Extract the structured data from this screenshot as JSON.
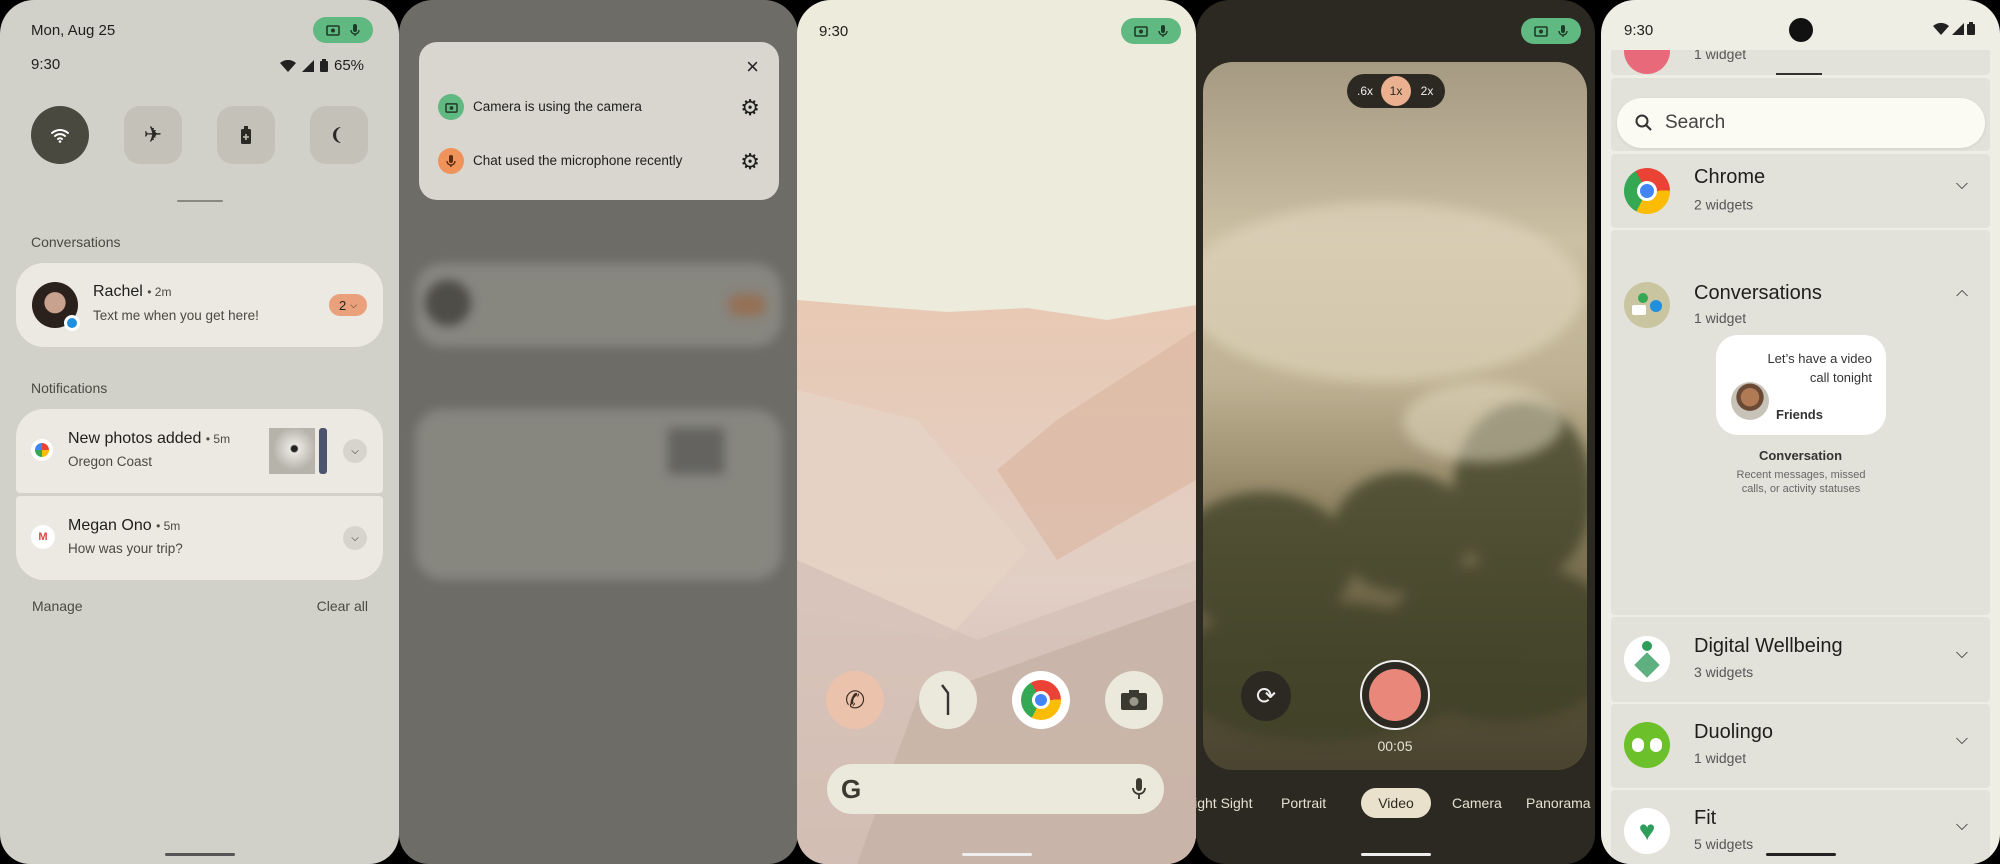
{
  "shade": {
    "date": "Mon, Aug 25",
    "time": "9:30",
    "battery": "65%",
    "tiles": [
      "wifi-icon",
      "airplane-icon",
      "battery-saver-icon",
      "dark-mode-icon"
    ],
    "conversations_header": "Conversations",
    "conversation": {
      "name": "Rachel",
      "time": "• 2m",
      "message": "Text me when you get here!",
      "count": "2"
    },
    "notifications_header": "Notifications",
    "notifications": [
      {
        "title": "New photos added",
        "time": "• 5m",
        "body": "Oregon Coast",
        "app": "google-photos-icon"
      },
      {
        "title": "Megan Ono",
        "time": "• 5m",
        "body": "How was your trip?",
        "app": "gmail-icon"
      }
    ],
    "manage": "Manage",
    "clear_all": "Clear all"
  },
  "privacy": {
    "items": [
      {
        "text": "Camera is using the camera",
        "color": "#5fb980"
      },
      {
        "text": "Chat used the microphone recently",
        "color": "#f0935a"
      }
    ]
  },
  "home": {
    "time": "9:30",
    "dock": [
      "phone-icon",
      "clock-icon",
      "chrome-icon",
      "camera-icon"
    ]
  },
  "camera": {
    "zoom": [
      ".6x",
      "1x",
      "2x"
    ],
    "timer": "00:05",
    "modes": [
      "Night Sight",
      "Portrait",
      "Video",
      "Camera",
      "Panorama"
    ],
    "active_mode": "Video"
  },
  "widgets": {
    "time": "9:30",
    "top_partial": "1 widget",
    "search_placeholder": "Search",
    "apps": [
      {
        "name": "Chrome",
        "count": "2 widgets"
      },
      {
        "name": "Conversations",
        "count": "1 widget"
      },
      {
        "name": "Digital Wellbeing",
        "count": "3 widgets"
      },
      {
        "name": "Duolingo",
        "count": "1 widget"
      },
      {
        "name": "Fit",
        "count": "5 widgets"
      }
    ],
    "preview": {
      "message": "Let’s have a video call tonight",
      "group": "Friends",
      "title": "Conversation",
      "description": "Recent messages, missed calls, or activity statuses"
    }
  },
  "colors": {
    "accent_green": "#5fb980",
    "accent_orange": "#f0935a",
    "record": "#e8877a",
    "shade_bg": "#d2d1c9"
  }
}
